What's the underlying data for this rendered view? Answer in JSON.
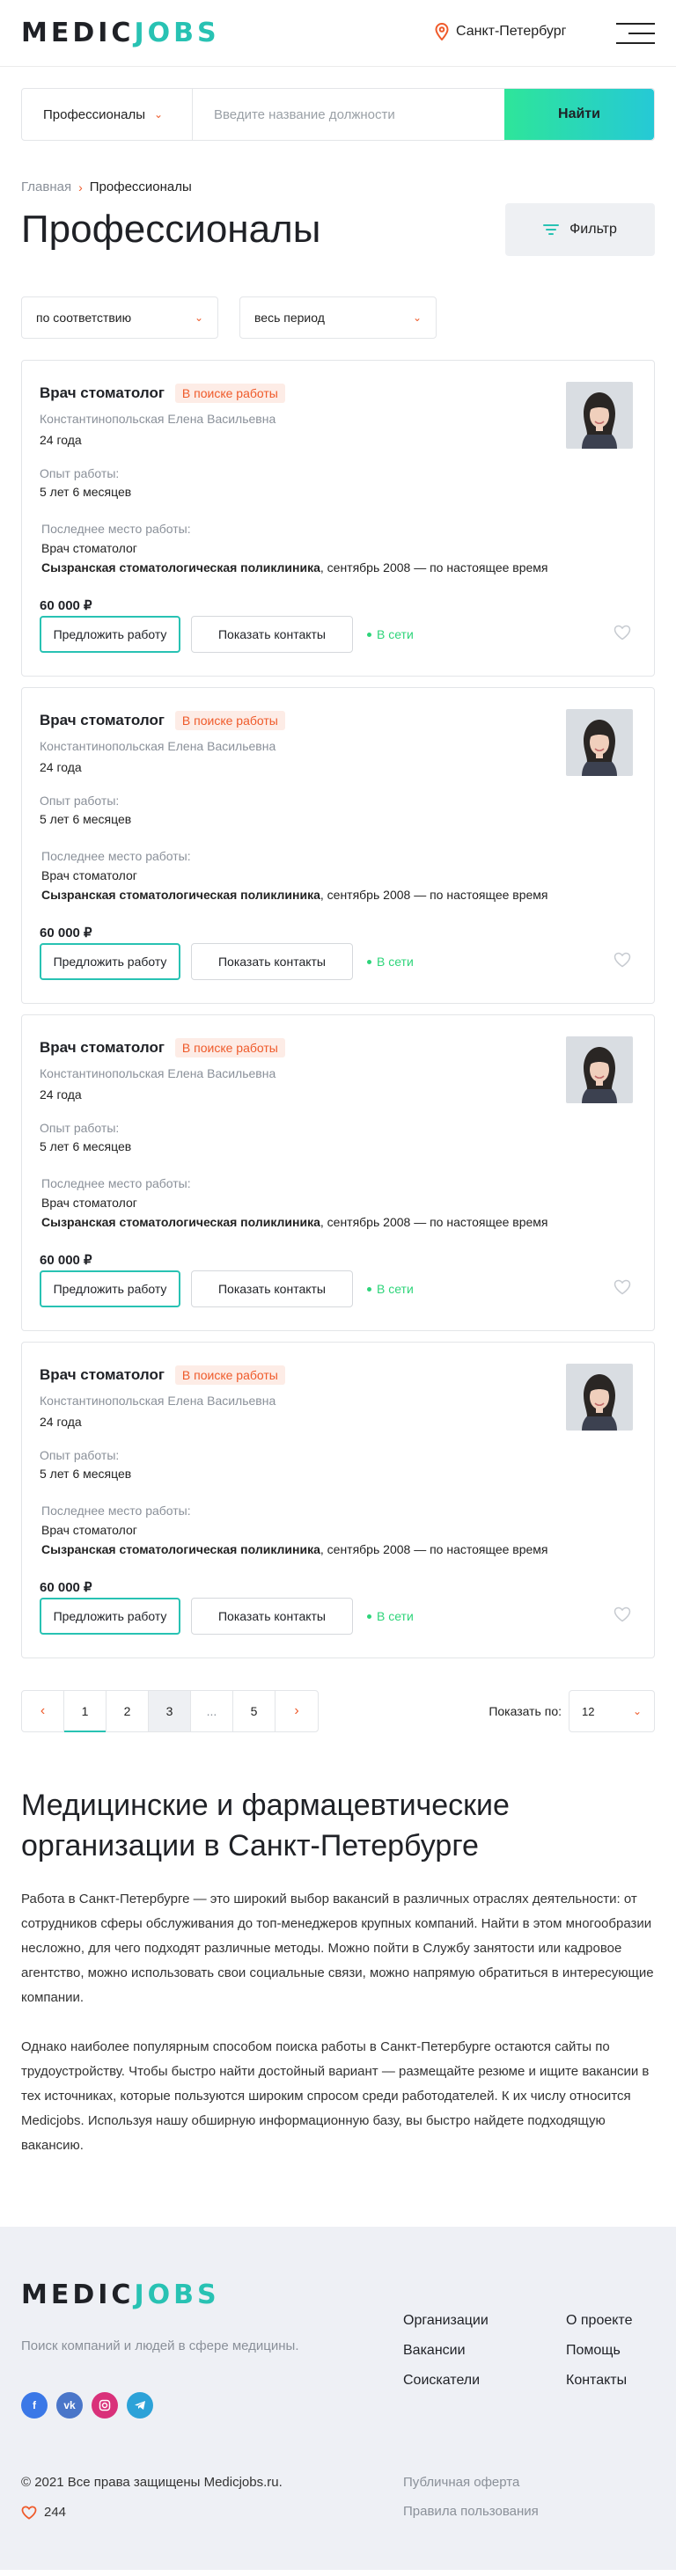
{
  "header": {
    "logo_part1": "MEDIC",
    "logo_part2": "JOBS",
    "city": "Санкт-Петербург"
  },
  "search": {
    "category": "Профессионалы",
    "placeholder": "Введите название должности",
    "button": "Найти"
  },
  "breadcrumb": {
    "home": "Главная",
    "current": "Профессионалы"
  },
  "page_title": "Профессионалы",
  "filter_label": "Фильтр",
  "sort": {
    "order": "по соответствию",
    "period": "весь период"
  },
  "cards": [
    {
      "title": "Врач стоматолог",
      "badge": "В поиске работы",
      "name": "Константинопольская Елена Васильевна",
      "age": "24 года",
      "experience_label": "Опыт работы:",
      "experience": "5 лет 6 месяцев",
      "last_label": "Последнее место работы:",
      "last_position": "Врач стоматолог",
      "last_org": "Сызранская стоматологическая поликлиника",
      "last_period": ", сентябрь 2008 — по настоящее время",
      "salary": "60 000 ₽",
      "offer": "Предложить работу",
      "contacts": "Показать контакты",
      "status": "В сети"
    },
    {
      "title": "Врач стоматолог",
      "badge": "В поиске работы",
      "name": "Константинопольская Елена Васильевна",
      "age": "24 года",
      "experience_label": "Опыт работы:",
      "experience": "5 лет 6 месяцев",
      "last_label": "Последнее место работы:",
      "last_position": "Врач стоматолог",
      "last_org": "Сызранская стоматологическая поликлиника",
      "last_period": ", сентябрь 2008 — по настоящее время",
      "salary": "60 000 ₽",
      "offer": "Предложить работу",
      "contacts": "Показать контакты",
      "status": "В сети"
    },
    {
      "title": "Врач стоматолог",
      "badge": "В поиске работы",
      "name": "Константинопольская Елена Васильевна",
      "age": "24 года",
      "experience_label": "Опыт работы:",
      "experience": "5 лет 6 месяцев",
      "last_label": "Последнее место работы:",
      "last_position": "Врач стоматолог",
      "last_org": "Сызранская стоматологическая поликлиника",
      "last_period": ", сентябрь 2008 — по настоящее время",
      "salary": "60 000 ₽",
      "offer": "Предложить работу",
      "contacts": "Показать контакты",
      "status": "В сети"
    },
    {
      "title": "Врач стоматолог",
      "badge": "В поиске работы",
      "name": "Константинопольская Елена Васильевна",
      "age": "24 года",
      "experience_label": "Опыт работы:",
      "experience": "5 лет 6 месяцев",
      "last_label": "Последнее место работы:",
      "last_position": "Врач стоматолог",
      "last_org": "Сызранская стоматологическая поликлиника",
      "last_period": ", сентябрь 2008 — по настоящее время",
      "salary": "60 000 ₽",
      "offer": "Предложить работу",
      "contacts": "Показать контакты",
      "status": "В сети"
    }
  ],
  "pagination": {
    "pages": [
      "1",
      "2",
      "3",
      "...",
      "5"
    ],
    "current_page": "1",
    "per_page_label": "Показать по:",
    "per_page_value": "12"
  },
  "seo": {
    "title": "Медицинские и фармацевтические организации в Санкт-Петербурге",
    "p1": "Работа в Санкт-Петербурге — это широкий выбор вакансий в различных отраслях деятельности: от сотрудников сферы обслуживания до топ-менеджеров крупных компаний. Найти в этом многообразии несложно, для чего подходят различные методы. Можно пойти в Службу занятости или кадровое агентство, можно использовать свои социальные связи, можно напрямую обратиться в интересующие компании.",
    "p2": "Однако наиболее популярным способом поиска работы в Санкт-Петербурге остаются сайты по трудоустройству. Чтобы быстро найти достойный вариант — размещайте резюме и ищите вакансии в тех источниках, которые пользуются широким спросом среди работодателей. К их числу относится Medicjobs. Используя нашу обширную информационную базу, вы быстро найдете подходящую вакансию."
  },
  "footer": {
    "tagline": "Поиск компаний и людей в сфере медицины.",
    "col1": [
      "Организации",
      "Вакансии",
      "Соискатели"
    ],
    "col2": [
      "О проекте",
      "Помощь",
      "Контакты"
    ],
    "copyright": "© 2021 Все права защищены Medicjobs.ru.",
    "likes": "244",
    "legal": [
      "Публичная оферта",
      "Правила пользования"
    ],
    "socials": [
      "facebook",
      "vk",
      "instagram",
      "telegram"
    ]
  },
  "colors": {
    "accent": "#28c2b3",
    "orange": "#ef5a2a",
    "online": "#2ed47a"
  }
}
